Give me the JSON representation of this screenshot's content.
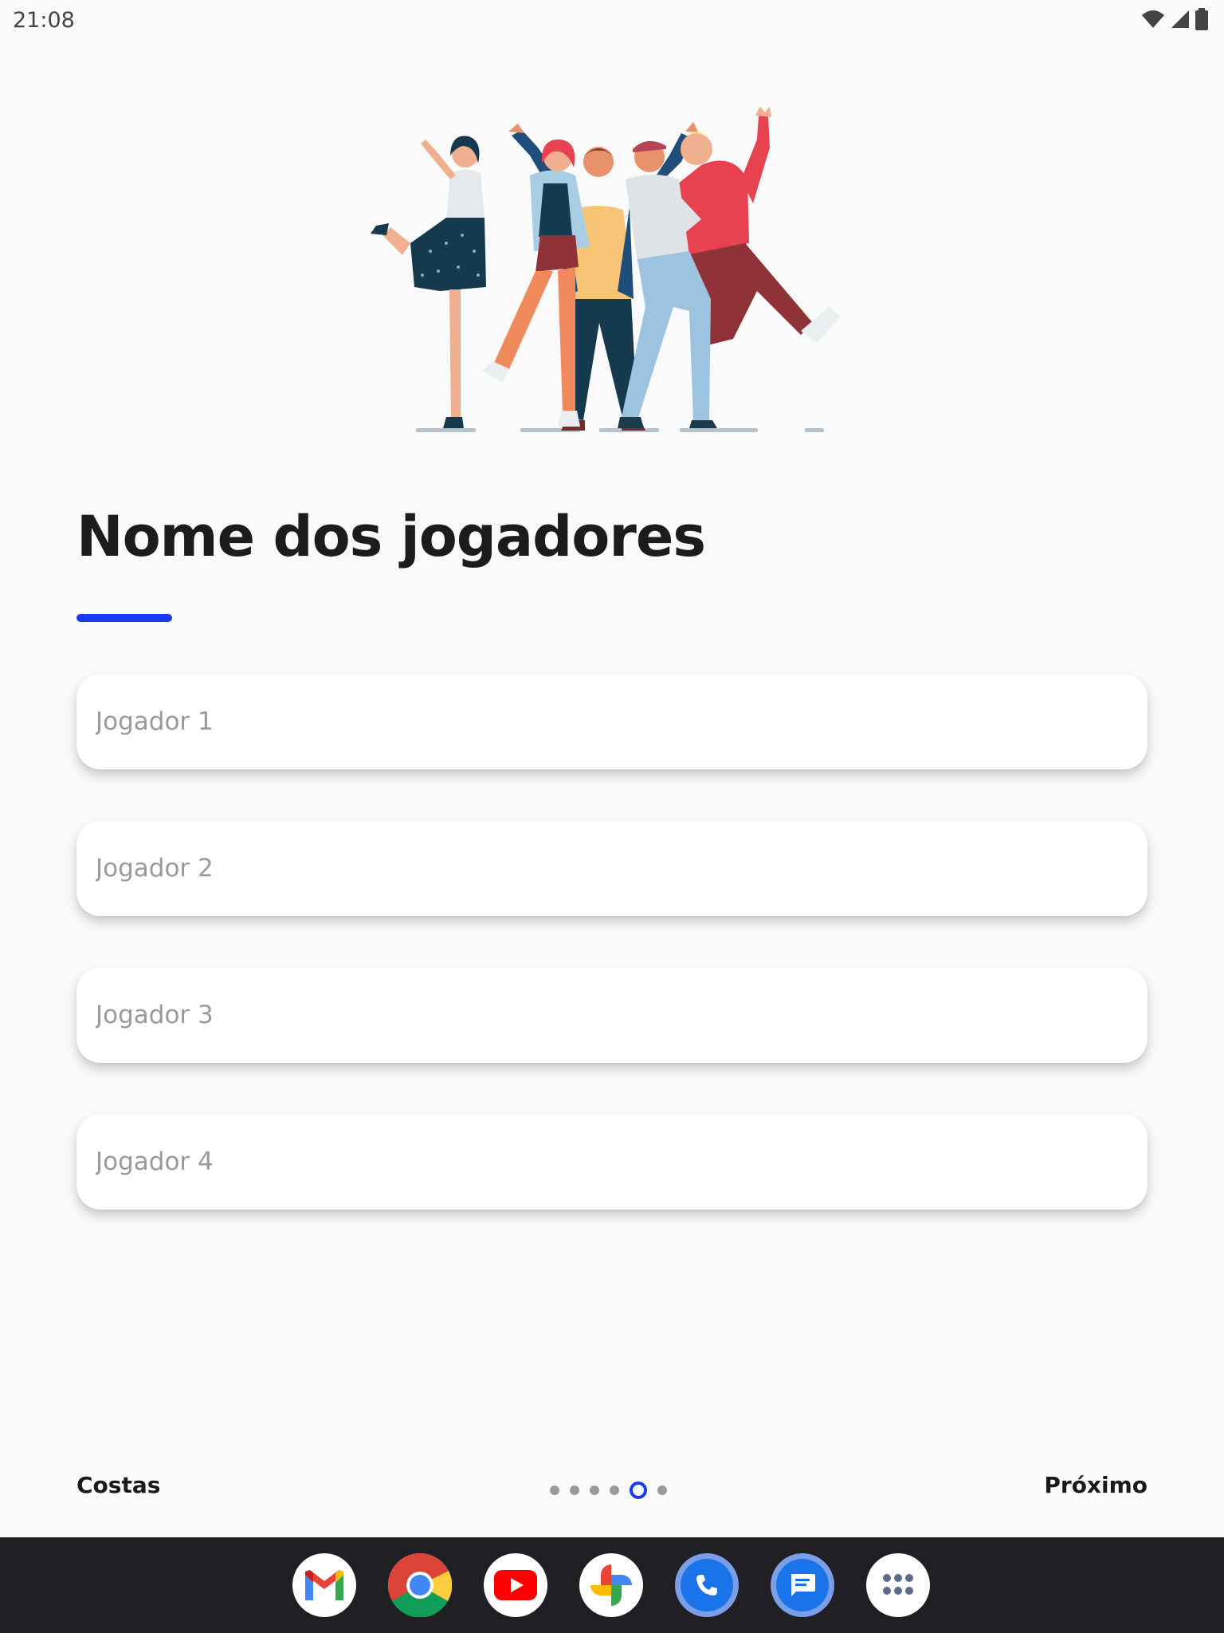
{
  "status_bar": {
    "time": "21:08",
    "icons": [
      "wifi-icon",
      "cellular-signal-icon",
      "battery-icon"
    ]
  },
  "illustration": {
    "description_icon": "group-of-friends-illustration"
  },
  "page": {
    "title": "Nome dos jogadores",
    "accent_color": "#1a3cf0"
  },
  "players": {
    "placeholders": [
      "Jogador 1",
      "Jogador 2",
      "Jogador 3",
      "Jogador 4"
    ]
  },
  "navigation": {
    "back_label": "Costas",
    "next_label": "Próximo",
    "page_count": 6,
    "current_page": 5
  },
  "dock": {
    "apps": [
      "gmail-icon",
      "chrome-icon",
      "youtube-icon",
      "photos-icon",
      "phone-icon",
      "messages-icon",
      "app-drawer-icon"
    ]
  }
}
